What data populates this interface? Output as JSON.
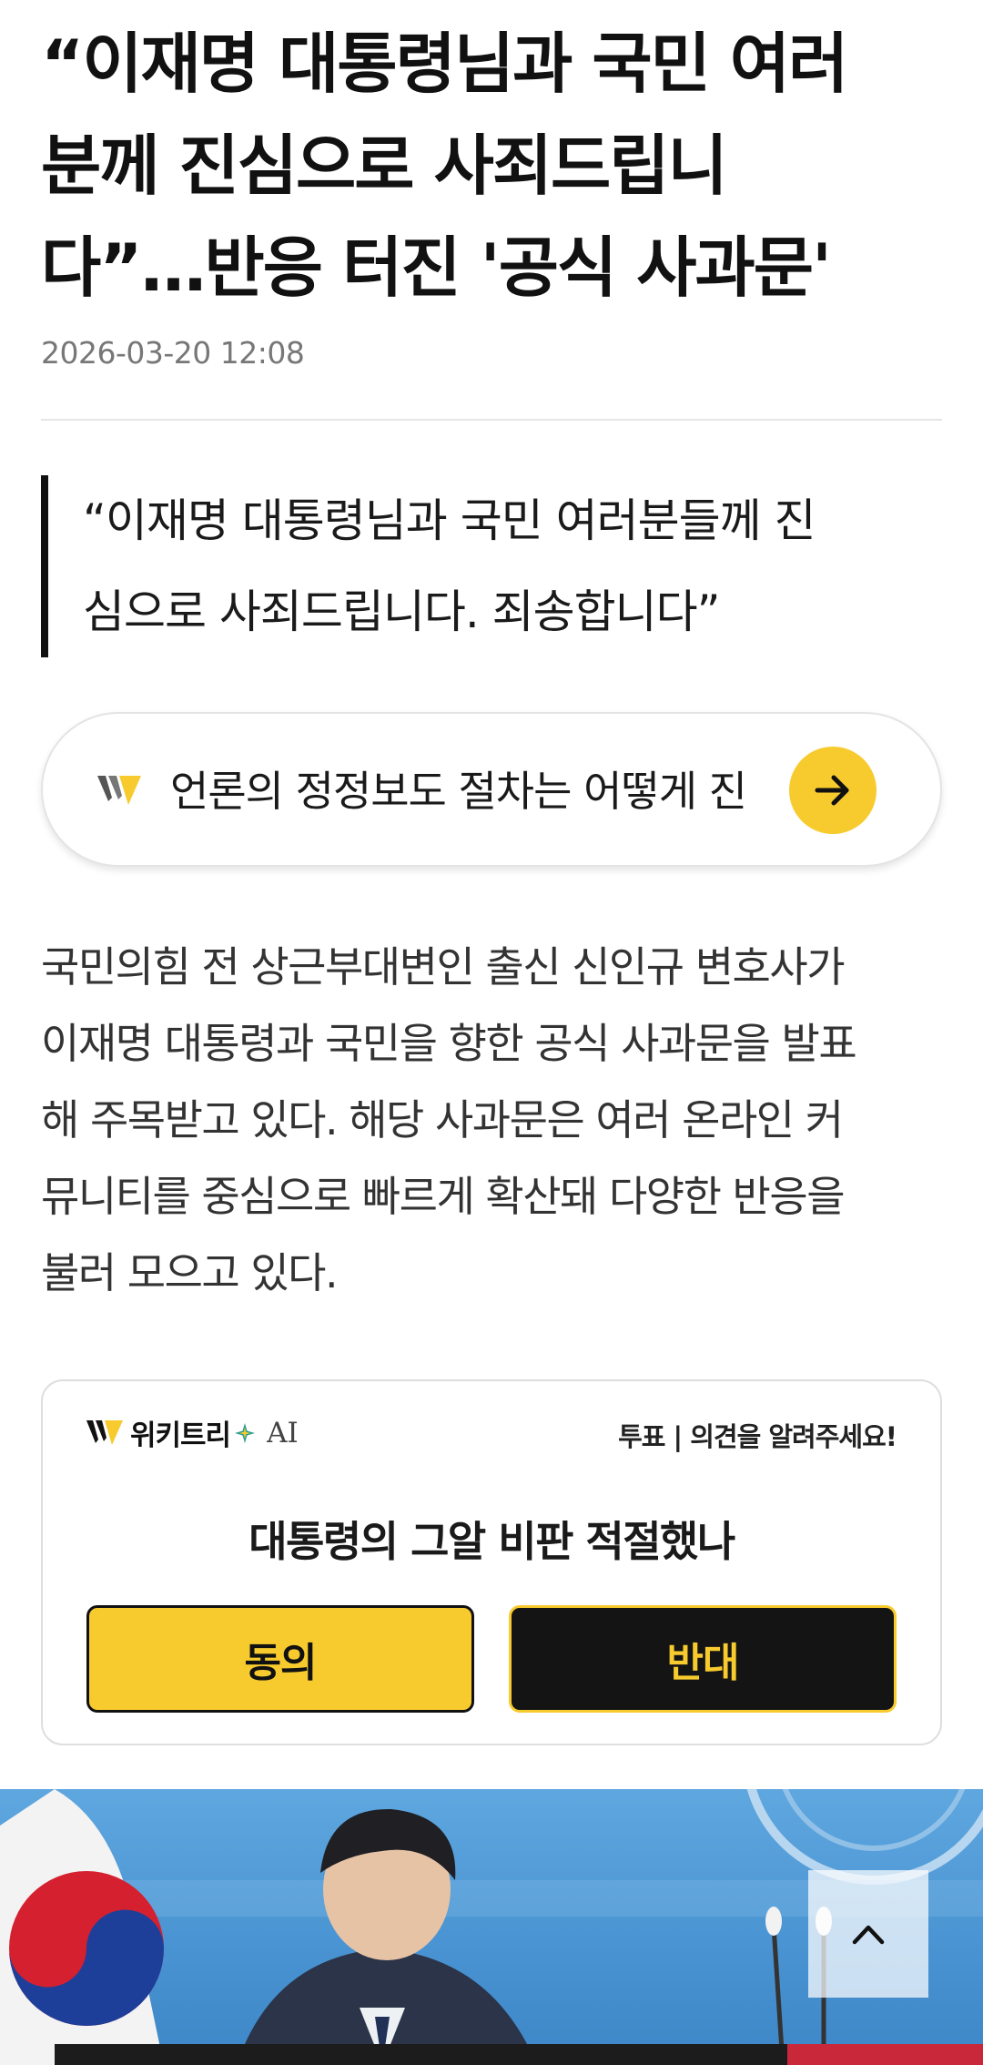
{
  "article": {
    "headline_lines": [
      "“이재명 대통령님과 국민 여러",
      "분께 진심으로 사죄드립니",
      "다”…반응 터진 '공식 사과문'"
    ],
    "date": "2026-03-20 12:08",
    "quote_lines": [
      "“이재명 대통령님과 국민 여러분들께 진",
      "심으로 사죄드립니다. 죄송합니다”"
    ],
    "body_lines": [
      "국민의힘 전 상근부대변인 출신 신인규 변호사가",
      "이재명 대통령과 국민을 향한 공식 사과문을 발표",
      "해 주목받고 있다. 해당 사과문은 여러 온라인 커",
      "뮤니티를 중심으로 빠르게 확산돼 다양한 반응을",
      "불러 모으고 있다."
    ]
  },
  "correction_banner": {
    "text": "언론의 정정보도 절차는 어떻게 진"
  },
  "poll": {
    "brand_name": "위키트리",
    "brand_ai": "AI",
    "tag": "투표 | 의견을 알려주세요!",
    "question": "대통령의 그알 비판 적절했나",
    "agree_label": "동의",
    "oppose_label": "반대"
  },
  "colors": {
    "accent_yellow": "#f7cb2e",
    "dark": "#141414",
    "photo_blue": "#4a94d3"
  },
  "icons": {
    "correction": "wikitree-logo",
    "arrow": "arrow-right-icon",
    "scroll": "chevron-up-icon"
  }
}
